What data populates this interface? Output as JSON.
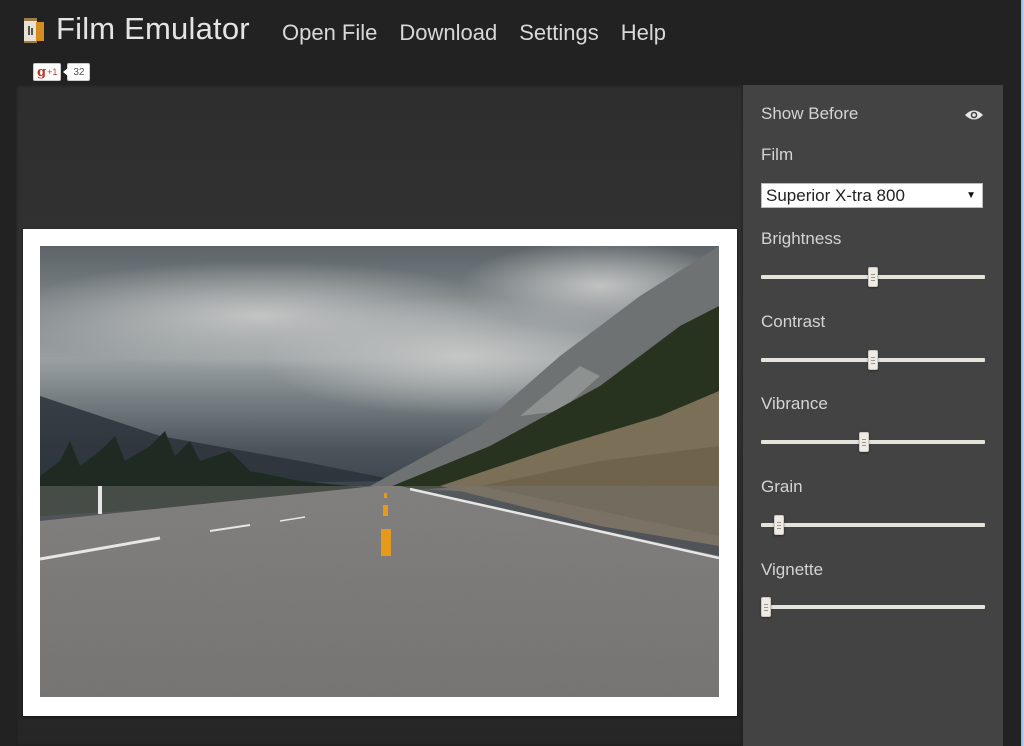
{
  "app": {
    "title": "Film Emulator",
    "logo_icon": "film-canister-icon"
  },
  "nav": {
    "items": [
      {
        "label": "Open File"
      },
      {
        "label": "Download"
      },
      {
        "label": "Settings"
      },
      {
        "label": "Help"
      }
    ]
  },
  "social": {
    "gplus_glyph": "g",
    "gplus_label": "+1",
    "gplus_count": "32"
  },
  "canvas": {
    "photo_description": "Mountain highway under storm clouds",
    "colors": {
      "frame": "#ffffff",
      "center_line": "#e59a1c"
    }
  },
  "sidebar": {
    "show_before": {
      "label": "Show Before",
      "icon": "eye-icon"
    },
    "film": {
      "label": "Film",
      "selected": "Superior X-tra 800",
      "arrow": "▼"
    },
    "sliders": [
      {
        "key": "brightness",
        "label": "Brightness",
        "value": 0.5
      },
      {
        "key": "contrast",
        "label": "Contrast",
        "value": 0.5
      },
      {
        "key": "vibrance",
        "label": "Vibrance",
        "value": 0.46
      },
      {
        "key": "grain",
        "label": "Grain",
        "value": 0.08
      },
      {
        "key": "vignette",
        "label": "Vignette",
        "value": 0.0
      }
    ]
  }
}
